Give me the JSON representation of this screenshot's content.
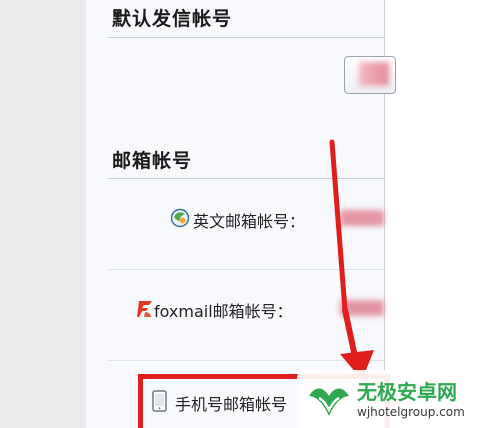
{
  "sections": {
    "default_sender": {
      "title": "默认发信帐号"
    },
    "mail_accounts": {
      "title": "邮箱帐号"
    }
  },
  "fields": {
    "english_account": {
      "label": "英文邮箱帐号：",
      "icon": "globe-icon"
    },
    "foxmail_account": {
      "label": "foxmail邮箱帐号：",
      "icon": "foxmail-logo-icon"
    },
    "phone_account": {
      "label": "手机号邮箱帐号",
      "icon": "mobile-phone-icon"
    }
  },
  "annotations": {
    "arrow_color": "#e01e1e",
    "highlight_color": "#e01e1e"
  },
  "watermark": {
    "brand": "无极安卓网",
    "url": "wjhotelgroup.com",
    "brand_color": "#2fa84f"
  }
}
